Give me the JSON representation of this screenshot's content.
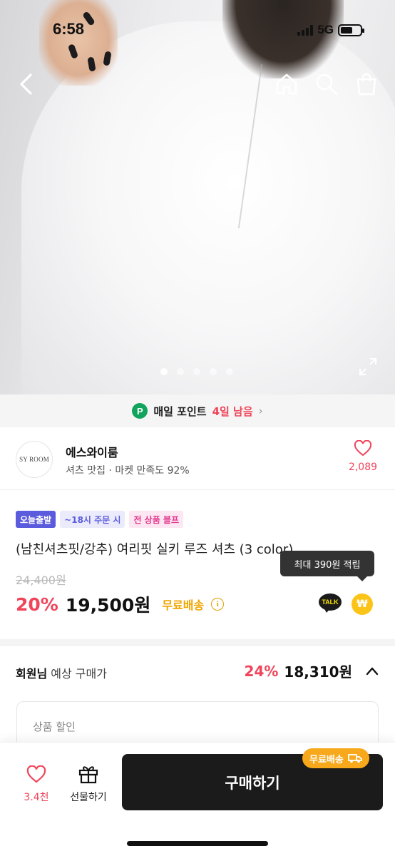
{
  "status_bar": {
    "time": "6:58",
    "network": "5G"
  },
  "header": {
    "back_icon": "chevron-left-icon",
    "home_icon": "home-icon",
    "search_icon": "search-icon",
    "bag_icon": "shopping-bag-icon"
  },
  "gallery": {
    "total_images": 5,
    "current_index": 1
  },
  "point_banner": {
    "label": "매일 포인트",
    "days_left": "4일 남음"
  },
  "shop": {
    "logo_text": "SY ROOM",
    "name": "에스와이룸",
    "meta": "셔츠 맛집 · 마켓 만족도 92%",
    "likes": "2,089"
  },
  "product": {
    "tags": [
      "오늘출발",
      "~18시 주문 시",
      "전 상품 블프"
    ],
    "title": "(남친셔츠핏/강추) 여리핏 실키 루즈 셔츠 (3 color)",
    "tooltip": "최대 390원 적립",
    "original_price": "24,400원",
    "discount": "20%",
    "price": "19,500원",
    "shipping": "무료배송",
    "talk_label": "TALK",
    "won_symbol": "₩"
  },
  "member": {
    "label_bold": "회원님",
    "label_rest": " 예상 구매가",
    "discount": "24%",
    "price": "18,310원"
  },
  "discount_box": {
    "label": "상품 할인"
  },
  "bottom_bar": {
    "wish_count": "3.4천",
    "gift_label": "선물하기",
    "buy_label": "구매하기",
    "shipping_badge": "무료배송"
  },
  "colors": {
    "accent_red": "#f0445a",
    "shipping_yellow": "#f0a500",
    "tag_purple": "#5b5bde",
    "tag_pink": "#e2378d",
    "point_green": "#11a45c",
    "buy_button": "#1b1b1b"
  }
}
